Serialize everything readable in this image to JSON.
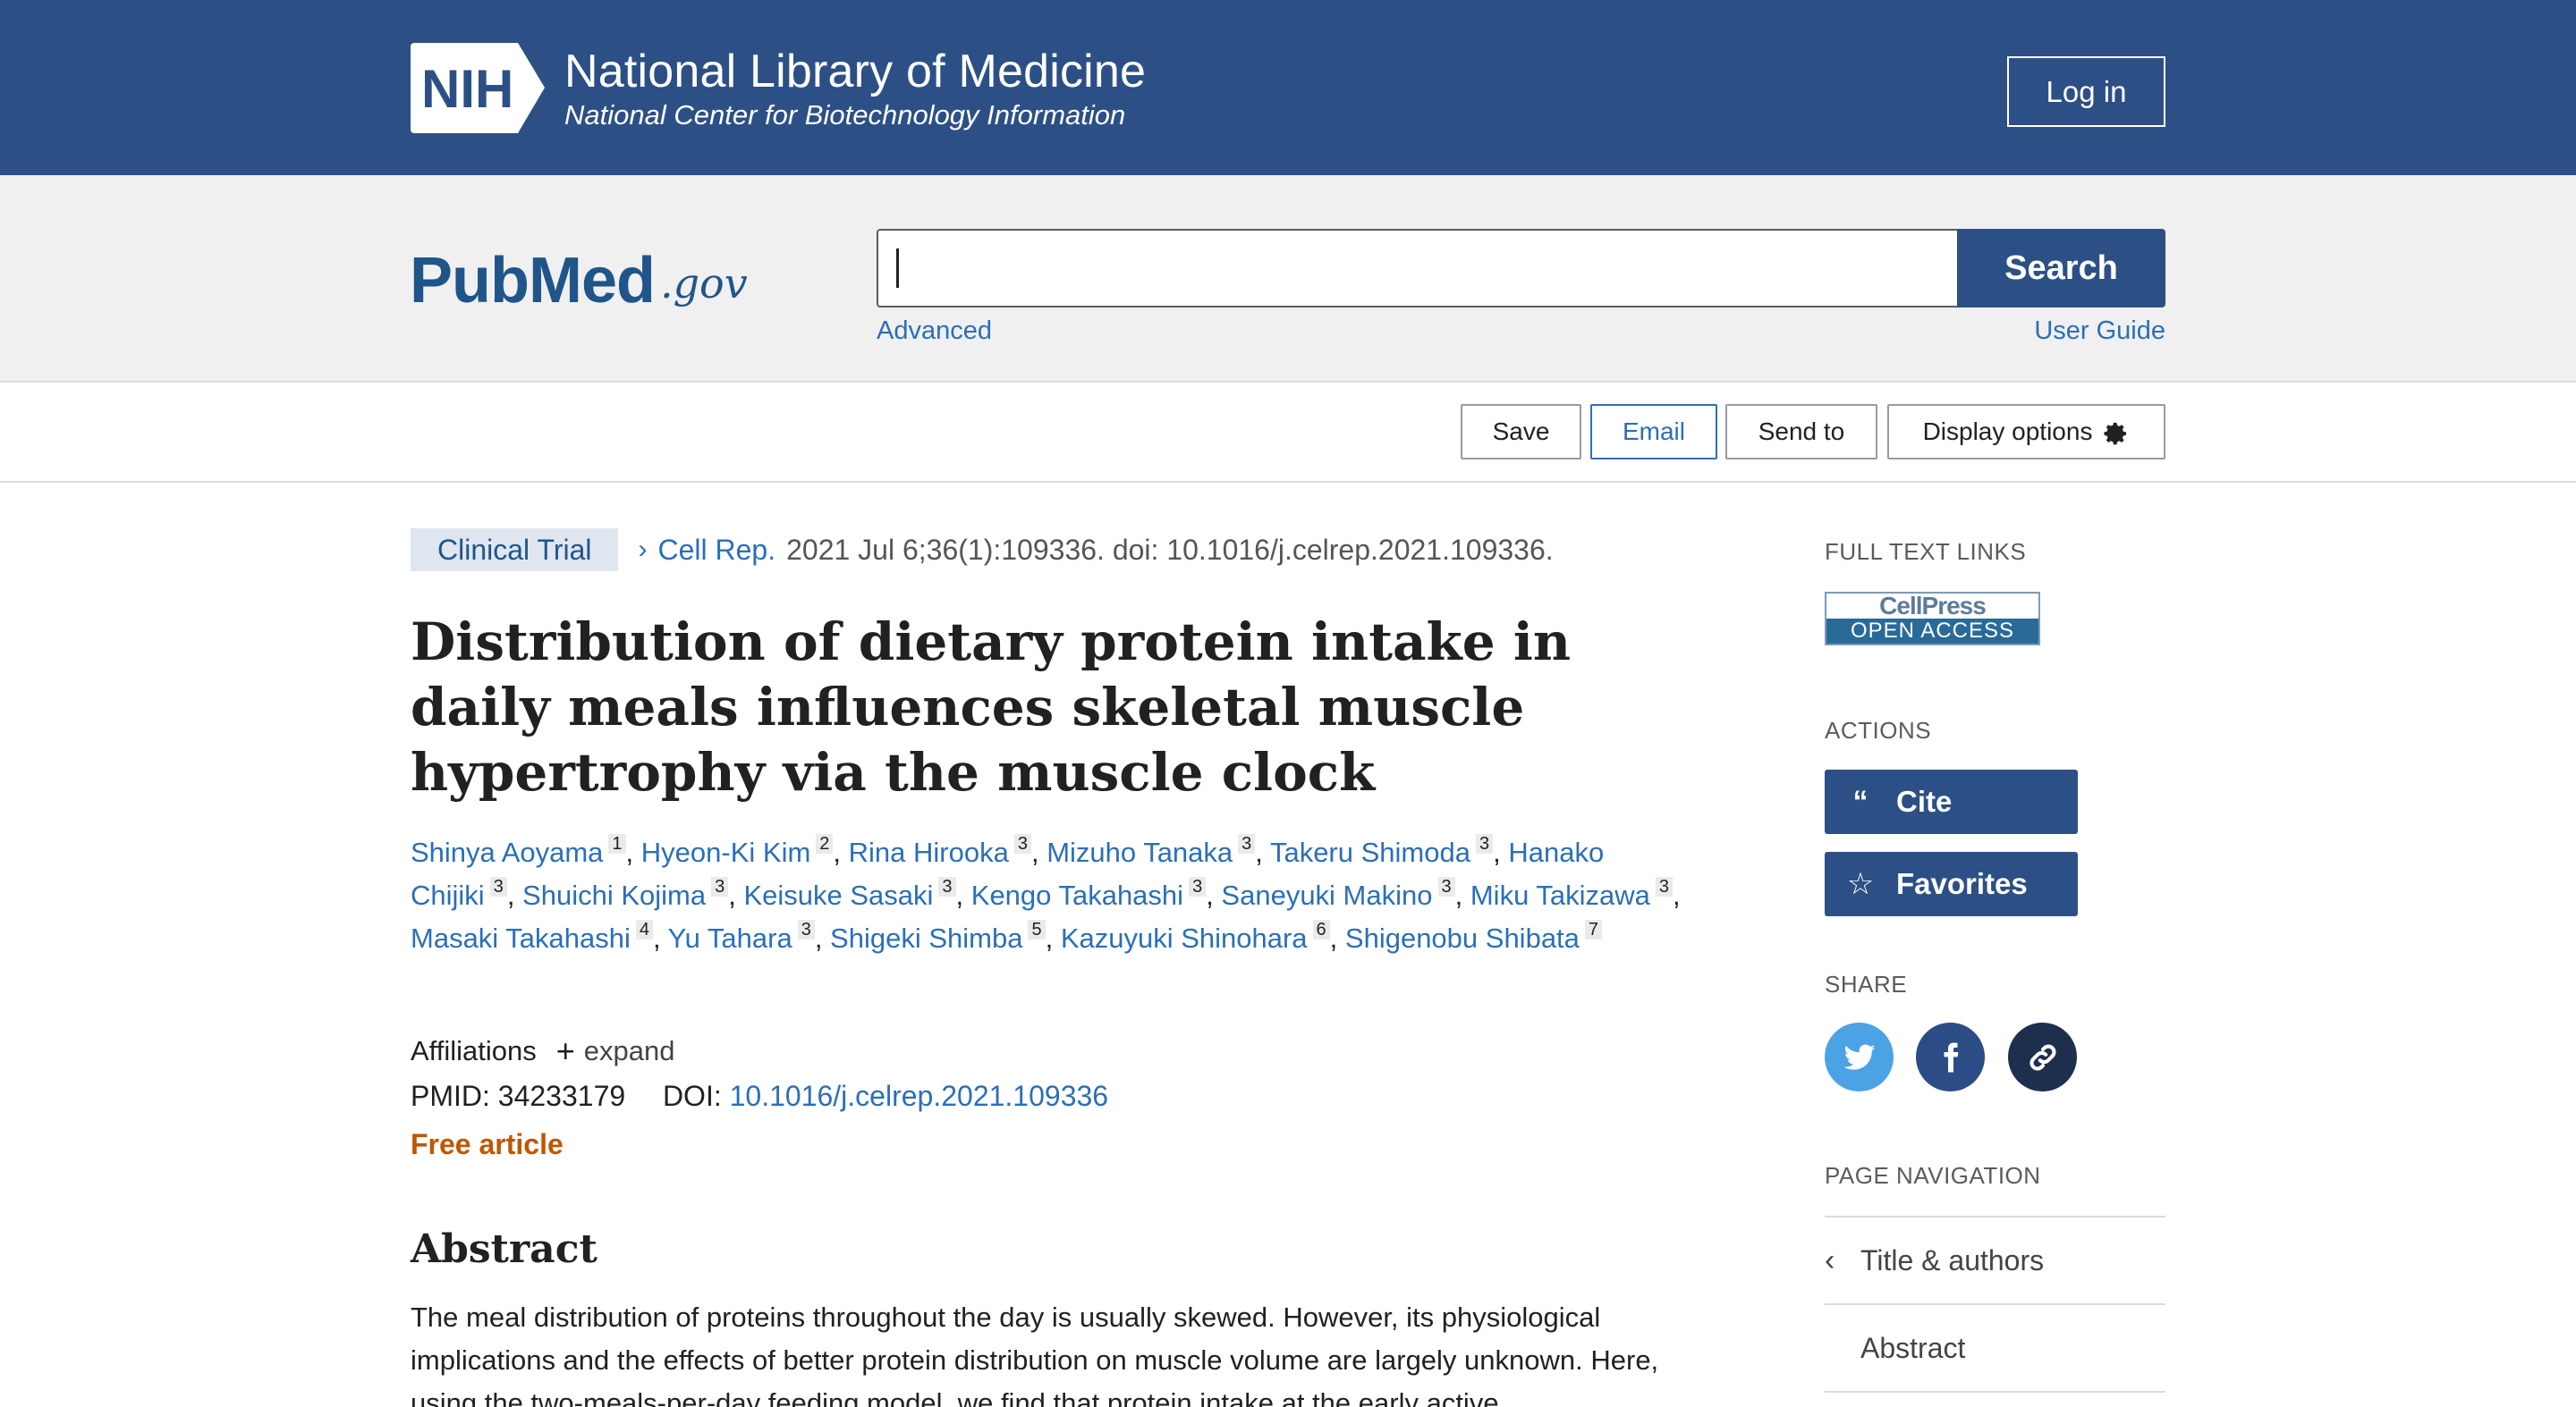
{
  "nih": {
    "logo_text": "NIH",
    "title": "National Library of Medicine",
    "subtitle": "National Center for Biotechnology Information",
    "login_label": "Log in"
  },
  "search": {
    "logo_word": "PubMed",
    "logo_gov": ".gov",
    "query": "",
    "button_label": "Search",
    "advanced_label": "Advanced",
    "user_guide_label": "User Guide"
  },
  "toolbar": {
    "save_label": "Save",
    "email_label": "Email",
    "send_to_label": "Send to",
    "display_options_label": "Display options"
  },
  "article": {
    "pub_type": "Clinical Trial",
    "journal": "Cell Rep.",
    "citation": "2021 Jul 6;36(1):109336. doi: 10.1016/j.celrep.2021.109336.",
    "title": "Distribution of dietary protein intake in daily meals influences skeletal muscle hypertrophy via the muscle clock",
    "authors": [
      {
        "name": "Shinya Aoyama",
        "aff": "1"
      },
      {
        "name": "Hyeon-Ki Kim",
        "aff": "2"
      },
      {
        "name": "Rina Hirooka",
        "aff": "3"
      },
      {
        "name": "Mizuho Tanaka",
        "aff": "3"
      },
      {
        "name": "Takeru Shimoda",
        "aff": "3"
      },
      {
        "name": "Hanako Chijiki",
        "aff": "3"
      },
      {
        "name": "Shuichi Kojima",
        "aff": "3"
      },
      {
        "name": "Keisuke Sasaki",
        "aff": "3"
      },
      {
        "name": "Kengo Takahashi",
        "aff": "3"
      },
      {
        "name": "Saneyuki Makino",
        "aff": "3"
      },
      {
        "name": "Miku Takizawa",
        "aff": "3"
      },
      {
        "name": "Masaki Takahashi",
        "aff": "4"
      },
      {
        "name": "Yu Tahara",
        "aff": "3"
      },
      {
        "name": "Shigeki Shimba",
        "aff": "5"
      },
      {
        "name": "Kazuyuki Shinohara",
        "aff": "6"
      },
      {
        "name": "Shigenobu Shibata",
        "aff": "7"
      }
    ],
    "affiliations_label": "Affiliations",
    "expand_label": "expand",
    "pmid_label": "PMID:",
    "pmid": "34233179",
    "doi_label": "DOI:",
    "doi": "10.1016/j.celrep.2021.109336",
    "free_label": "Free article",
    "abstract_heading": "Abstract",
    "abstract_text": "The meal distribution of proteins throughout the day is usually skewed. However, its physiological implications and the effects of better protein distribution on muscle volume are largely unknown. Here, using the two-meals-per-day feeding model, we find that protein intake at the early active"
  },
  "sidebar": {
    "full_text_heading": "FULL TEXT LINKS",
    "cellpress_top": "CellPress",
    "cellpress_bottom": "OPEN ACCESS",
    "actions_heading": "ACTIONS",
    "cite_label": "Cite",
    "favorites_label": "Favorites",
    "share_heading": "SHARE",
    "page_nav_heading": "PAGE NAVIGATION",
    "nav_items": [
      "Title & authors",
      "Abstract"
    ]
  },
  "colors": {
    "nih_blue": "#2c5085",
    "link_blue": "#2a6fb8",
    "free_orange": "#c05600",
    "twitter": "#4ba3e6",
    "facebook": "#2c4c86",
    "permalink": "#1e2f4e"
  }
}
